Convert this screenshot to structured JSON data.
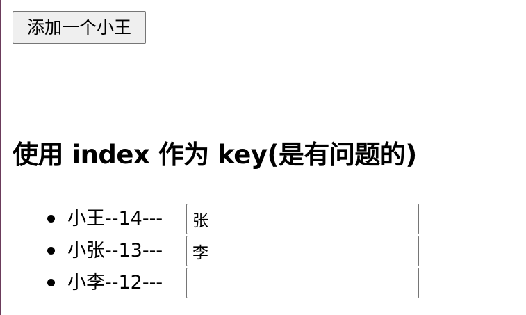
{
  "toolbar": {
    "add_button_label": "添加一个小王"
  },
  "heading": {
    "title": "使用 index 作为 key(是有问题的)"
  },
  "people": [
    {
      "label": "小王--14---",
      "input_value": "张"
    },
    {
      "label": "小张--13---",
      "input_value": "李"
    },
    {
      "label": "小李--12---",
      "input_value": ""
    }
  ],
  "colors": {
    "left_edge": "#6b3b5b",
    "button_bg": "#efefef",
    "border": "#767676"
  }
}
